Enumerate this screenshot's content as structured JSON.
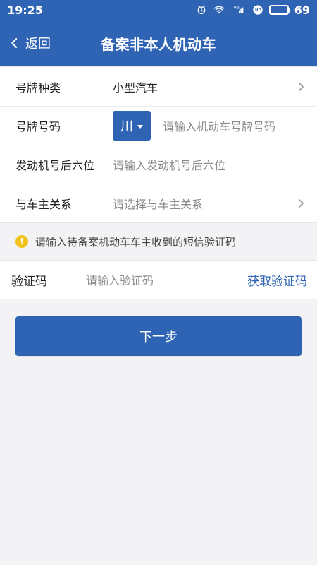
{
  "status_bar": {
    "time": "19:25",
    "network_label": "4G",
    "battery_level_label": "69",
    "battery_level_fraction": 0.69
  },
  "nav": {
    "back_label": "返回",
    "title": "备案非本人机动车"
  },
  "form": {
    "plate_type": {
      "label": "号牌种类",
      "value": "小型汽车"
    },
    "plate_number": {
      "label": "号牌号码",
      "province": "川",
      "placeholder": "请输入机动车号牌号码"
    },
    "engine_last6": {
      "label": "发动机号后六位",
      "placeholder": "请输入发动机号后六位"
    },
    "relationship": {
      "label": "与车主关系",
      "placeholder": "请选择与车主关系"
    }
  },
  "notice": {
    "text": "请输入待备案机动车车主收到的短信验证码"
  },
  "verification": {
    "label": "验证码",
    "placeholder": "请输入验证码",
    "get_code": "获取验证码"
  },
  "actions": {
    "next_label": "下一步"
  },
  "colors": {
    "primary": "#2f63b3",
    "background": "#f3f3f5",
    "notice_icon": "#f3c21a"
  }
}
